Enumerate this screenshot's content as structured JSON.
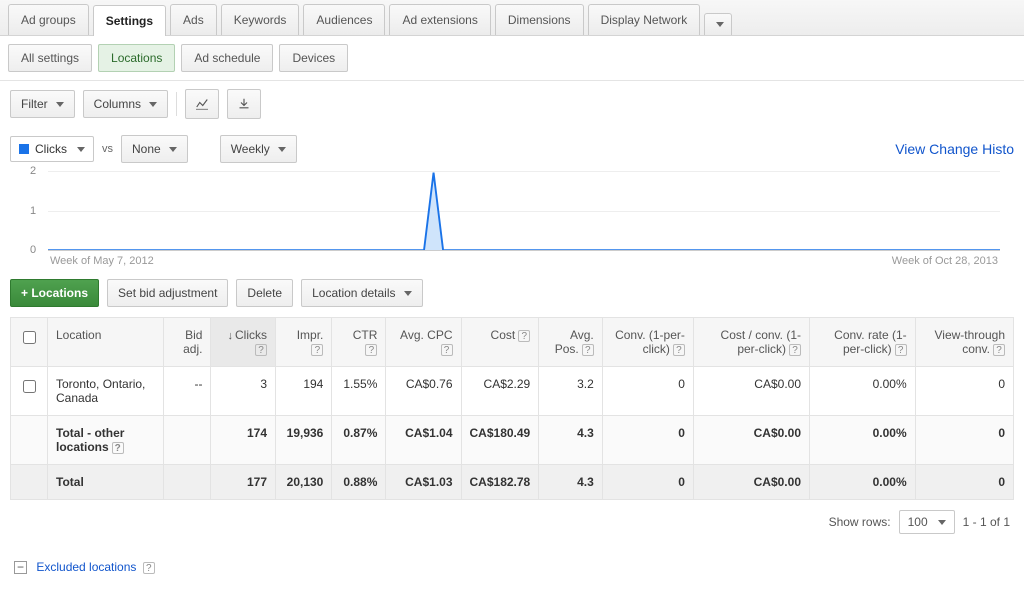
{
  "tabs_primary": [
    {
      "label": "Ad groups",
      "active": false
    },
    {
      "label": "Settings",
      "active": true
    },
    {
      "label": "Ads",
      "active": false
    },
    {
      "label": "Keywords",
      "active": false
    },
    {
      "label": "Audiences",
      "active": false
    },
    {
      "label": "Ad extensions",
      "active": false
    },
    {
      "label": "Dimensions",
      "active": false
    },
    {
      "label": "Display Network",
      "active": false
    }
  ],
  "tabs_sub": [
    {
      "label": "All settings",
      "active": false
    },
    {
      "label": "Locations",
      "active": true
    },
    {
      "label": "Ad schedule",
      "active": false
    },
    {
      "label": "Devices",
      "active": false
    }
  ],
  "toolbar": {
    "filter": "Filter",
    "columns": "Columns"
  },
  "chart_controls": {
    "metric_primary": "Clicks",
    "vs": "vs",
    "metric_secondary": "None",
    "granularity": "Weekly",
    "change_history": "View Change Histo"
  },
  "chart_data": {
    "type": "line",
    "ylabel": "",
    "xlabel": "",
    "ylim": [
      0,
      2
    ],
    "yticks": [
      0,
      1,
      2
    ],
    "x_range_labels": [
      "Week of May 7, 2012",
      "Week of Oct 28, 2013"
    ],
    "series": [
      {
        "name": "Clicks",
        "color": "#1a73e8",
        "values_note": "Single spike to ~2 around ~40% of range, 0 elsewhere"
      }
    ]
  },
  "actions": {
    "add_locations": "+ Locations",
    "set_bid": "Set bid adjustment",
    "delete": "Delete",
    "details": "Location details"
  },
  "table": {
    "headers": {
      "location": "Location",
      "bid_adj": "Bid adj.",
      "clicks": "Clicks",
      "impr": "Impr.",
      "ctr": "CTR",
      "avg_cpc": "Avg. CPC",
      "cost": "Cost",
      "avg_pos": "Avg. Pos.",
      "conv": "Conv. (1-per-click)",
      "cost_conv": "Cost / conv. (1-per-click)",
      "conv_rate": "Conv. rate (1-per-click)",
      "vtc": "View-through conv."
    },
    "rows": [
      {
        "location": "Toronto, Ontario, Canada",
        "bid_adj": "--",
        "clicks": "3",
        "impr": "194",
        "ctr": "1.55%",
        "avg_cpc": "CA$0.76",
        "cost": "CA$2.29",
        "avg_pos": "3.2",
        "conv": "0",
        "cost_conv": "CA$0.00",
        "conv_rate": "0.00%",
        "vtc": "0"
      }
    ],
    "other": {
      "label": "Total - other locations",
      "clicks": "174",
      "impr": "19,936",
      "ctr": "0.87%",
      "avg_cpc": "CA$1.04",
      "cost": "CA$180.49",
      "avg_pos": "4.3",
      "conv": "0",
      "cost_conv": "CA$0.00",
      "conv_rate": "0.00%",
      "vtc": "0"
    },
    "total": {
      "label": "Total",
      "clicks": "177",
      "impr": "20,130",
      "ctr": "0.88%",
      "avg_cpc": "CA$1.03",
      "cost": "CA$182.78",
      "avg_pos": "4.3",
      "conv": "0",
      "cost_conv": "CA$0.00",
      "conv_rate": "0.00%",
      "vtc": "0"
    }
  },
  "pager": {
    "show_rows": "Show rows:",
    "value": "100",
    "range": "1 - 1 of 1"
  },
  "excluded": {
    "label": "Excluded locations"
  }
}
